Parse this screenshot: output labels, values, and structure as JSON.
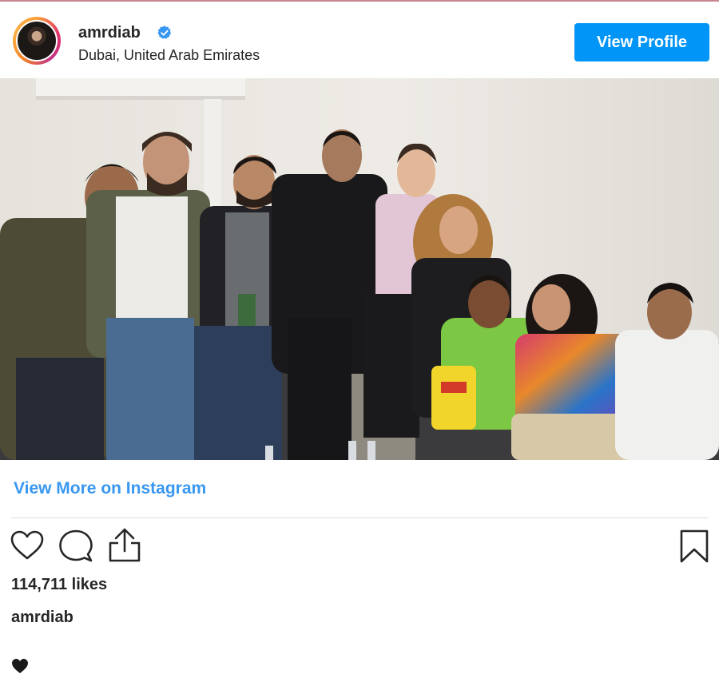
{
  "header": {
    "username": "amrdiab",
    "location": "Dubai, United Arab Emirates",
    "verified": true,
    "view_profile_label": "View Profile"
  },
  "post": {
    "image_description_icon": "group-photo",
    "view_more_label": "View More on Instagram",
    "likes": "114,711 likes",
    "caption_username": "amrdiab",
    "caption_emoji": "♥"
  },
  "colors": {
    "accent": "#0095f6",
    "link": "#3897f0",
    "text": "#262626",
    "verified": "#3897f0"
  },
  "icons": {
    "like": "heart-outline-icon",
    "comment": "comment-bubble-icon",
    "share": "share-icon",
    "save": "bookmark-icon",
    "verified": "verified-badge-icon",
    "caption": "black-heart-icon"
  }
}
